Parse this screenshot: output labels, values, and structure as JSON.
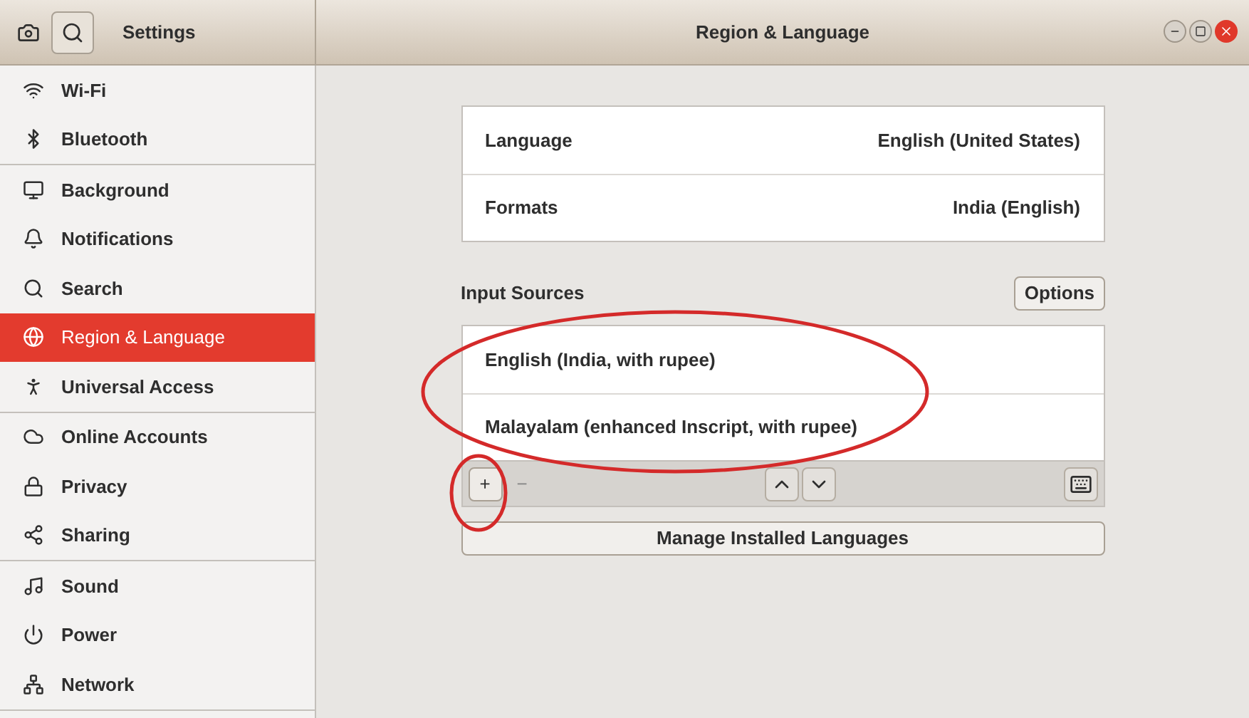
{
  "header": {
    "sidebar_title": "Settings",
    "title": "Region & Language"
  },
  "sidebar": {
    "groups": [
      [
        {
          "label": "Wi-Fi",
          "selected": false
        },
        {
          "label": "Bluetooth",
          "selected": false
        }
      ],
      [
        {
          "label": "Background",
          "selected": false
        },
        {
          "label": "Notifications",
          "selected": false
        },
        {
          "label": "Search",
          "selected": false
        },
        {
          "label": "Region & Language",
          "selected": true
        },
        {
          "label": "Universal Access",
          "selected": false
        }
      ],
      [
        {
          "label": "Online Accounts",
          "selected": false
        },
        {
          "label": "Privacy",
          "selected": false
        },
        {
          "label": "Sharing",
          "selected": false
        }
      ],
      [
        {
          "label": "Sound",
          "selected": false
        },
        {
          "label": "Power",
          "selected": false
        },
        {
          "label": "Network",
          "selected": false
        }
      ]
    ]
  },
  "settings": [
    {
      "label": "Language",
      "value": "English (United States)"
    },
    {
      "label": "Formats",
      "value": "India (English)"
    }
  ],
  "input_sources": {
    "heading": "Input Sources",
    "options_button": "Options",
    "items": [
      "English (India, with rupee)",
      "Malayalam (enhanced Inscript, with rupee)"
    ],
    "add_symbol": "+",
    "remove_symbol": "−"
  },
  "manage_button": "Manage Installed Languages"
}
